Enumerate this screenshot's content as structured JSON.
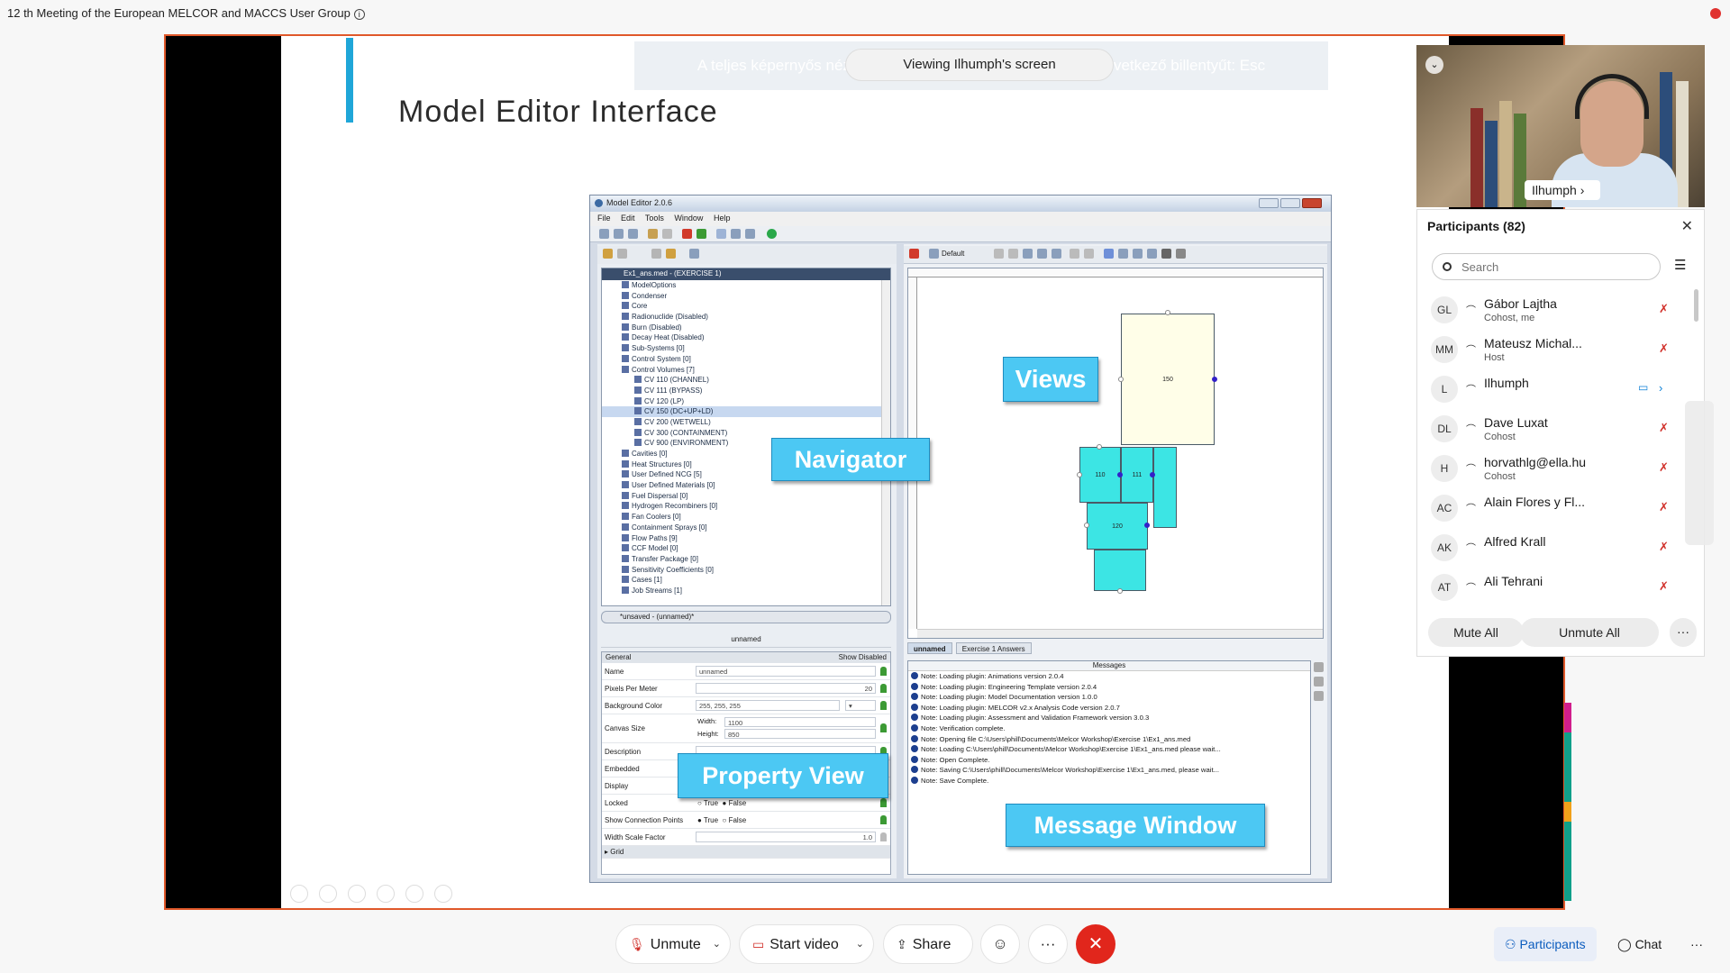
{
  "meeting": {
    "title": "12 th Meeting of the European MELCOR and MACCS User Group",
    "info_icon": "i"
  },
  "share": {
    "banner_text": "A teljes képernyős nézetből való kilépéshez nyomja meg a következő billentyűt: Esc",
    "viewing_label": "Viewing Ilhumph's screen"
  },
  "slide": {
    "title": "Model Editor Interface",
    "logo": "ꟷ",
    "callouts": {
      "navigator": "Navigator",
      "views": "Views",
      "property_view": "Property View",
      "message_window": "Message Window"
    }
  },
  "app": {
    "title": "Model Editor 2.0.6",
    "menu": [
      "File",
      "Edit",
      "Tools",
      "Window",
      "Help"
    ],
    "tree_header": "Ex1_ans.med - (EXERCISE 1)",
    "tree": [
      "ModelOptions",
      "Condenser",
      "Core",
      "Radionuclide (Disabled)",
      "Burn (Disabled)",
      "Decay Heat (Disabled)",
      "Sub-Systems [0]",
      "Control System [0]",
      "Control Volumes [7]",
      "CV 110 (CHANNEL)",
      "CV 111 (BYPASS)",
      "CV 120 (LP)",
      "CV 150 (DC+UP+LD)",
      "CV 200 (WETWELL)",
      "CV 300 (CONTAINMENT)",
      "CV 900 (ENVIRONMENT)",
      "Cavities [0]",
      "Heat Structures [0]",
      "User Defined NCG [5]",
      "User Defined Materials [0]",
      "Fuel Dispersal [0]",
      "Hydrogen Recombiners [0]",
      "Fan Coolers [0]",
      "Containment Sprays [0]",
      "Flow Paths [9]",
      "CCF Model [0]",
      "Transfer Package [0]",
      "Sensitivity Coefficients [0]",
      "Cases [1]",
      "Job Streams [1]"
    ],
    "nav_status": "*unsaved - (unnamed)*",
    "prop_head": "unnamed",
    "prop_general": "General",
    "show_disabled": "Show Disabled",
    "props": {
      "name_label": "Name",
      "name_value": "unnamed",
      "ppm_label": "Pixels Per Meter",
      "ppm_value": "20",
      "bg_label": "Background Color",
      "bg_value": "255, 255, 255",
      "canvas_label": "Canvas Size",
      "width_label": "Width:",
      "width_value": "1100",
      "height_label": "Height:",
      "height_value": "850",
      "desc_label": "Description",
      "embed_label": "Embedded",
      "display_label": "Display",
      "locked_label": "Locked",
      "true_label": "True",
      "false_label": "False",
      "scp_label": "Show Connection Points",
      "wsf_label": "Width Scale Factor",
      "wsf_value": "1.0",
      "grid_label": "Grid"
    },
    "view_toolbar_default": "Default",
    "cv_labels": {
      "cv150": "150",
      "cv110": "110",
      "cv111": "111",
      "cv120": "120"
    },
    "view_tabs": [
      "unnamed",
      "Exercise 1 Answers"
    ],
    "messages_head": "Messages",
    "messages": [
      "Note: Loading plugin: Animations version 2.0.4",
      "Note: Loading plugin: Engineering Template version 2.0.4",
      "Note: Loading plugin: Model Documentation version 1.0.0",
      "Note: Loading plugin: MELCOR v2.x Analysis Code version 2.0.7",
      "Note: Loading plugin: Assessment and Validation Framework version 3.0.3",
      "Note: Verification complete.",
      "Note: Opening file C:\\Users\\phill\\Documents\\Melcor Workshop\\Exercise 1\\Ex1_ans.med",
      "Note: Loading C:\\Users\\phill\\Documents\\Melcor Workshop\\Exercise 1\\Ex1_ans.med please wait...",
      "Note: Open Complete.",
      "Note: Saving C:\\Users\\phill\\Documents\\Melcor Workshop\\Exercise 1\\Ex1_ans.med, please wait...",
      "Note: Save Complete."
    ]
  },
  "video": {
    "name": "Ilhumph"
  },
  "participants": {
    "title": "Participants (82)",
    "search_placeholder": "Search",
    "list": [
      {
        "initials": "GL",
        "name": "Gábor Lajtha",
        "role": "Cohost, me"
      },
      {
        "initials": "MM",
        "name": "Mateusz Michal...",
        "role": "Host"
      },
      {
        "initials": "L",
        "name": "Ilhumph",
        "role": ""
      },
      {
        "initials": "DL",
        "name": "Dave Luxat",
        "role": "Cohost"
      },
      {
        "initials": "H",
        "name": "horvathlg@ella.hu",
        "role": "Cohost"
      },
      {
        "initials": "AC",
        "name": "Alain Flores y Fl...",
        "role": ""
      },
      {
        "initials": "AK",
        "name": "Alfred Krall",
        "role": ""
      },
      {
        "initials": "AT",
        "name": "Ali Tehrani",
        "role": ""
      }
    ],
    "mute_all": "Mute All",
    "unmute_all": "Unmute All",
    "more": "···"
  },
  "controls": {
    "unmute": "Unmute",
    "start_video": "Start video",
    "share": "Share",
    "more": "···",
    "participants": "Participants",
    "chat": "Chat",
    "overflow": "···"
  }
}
